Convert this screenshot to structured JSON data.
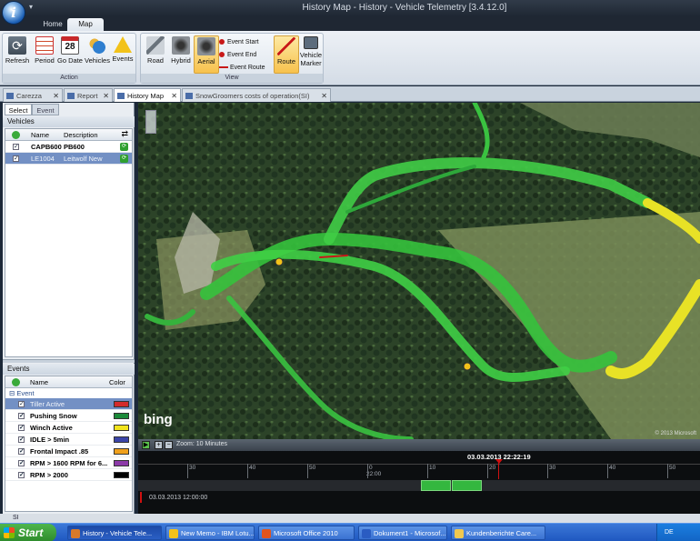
{
  "app": {
    "window_title": "History Map - History - Vehicle Telemetry [3.4.12.0]",
    "ribbon_tabs": [
      "Home",
      "Map"
    ],
    "active_ribbon_tab": "Map"
  },
  "ribbon": {
    "action_group": {
      "label": "Action",
      "buttons": [
        "Refresh",
        "Period",
        "Go Date",
        "Vehicles",
        "Events"
      ],
      "calendar_day": "28"
    },
    "view_group": {
      "label": "View",
      "buttons": [
        "Road",
        "Hybrid",
        "Aerial"
      ],
      "active": "Aerial",
      "small_buttons": [
        "Event Start",
        "Event End",
        "Event Route"
      ],
      "route_label": "Route",
      "vehicle_marker_label": "Vehicle Marker"
    }
  },
  "doc_tabs": [
    "Carezza",
    "Report",
    "History Map",
    "SnowGroomers costs of operation(SI)"
  ],
  "active_doc_tab": "History Map",
  "left_panel": {
    "subtabs": [
      "Select",
      "Event"
    ],
    "vehicles_title": "Vehicles",
    "vehicles_columns": [
      "Name",
      "Description"
    ],
    "vehicles": [
      {
        "name": "CAPB600",
        "description": "PB600",
        "selected": false
      },
      {
        "name": "LE1004",
        "description": "Leitwolf New",
        "selected": true
      }
    ],
    "events_title": "Events",
    "events_columns": [
      "Name",
      "Color"
    ],
    "event_group": "Event",
    "events": [
      {
        "name": "Tiller Active",
        "color": "#d42b2b",
        "selected": true
      },
      {
        "name": "Pushing Snow",
        "color": "#1c8a3a",
        "selected": false
      },
      {
        "name": "Winch Active",
        "color": "#f2e41c",
        "selected": false
      },
      {
        "name": "IDLE > 5min",
        "color": "#3a44a8",
        "selected": false
      },
      {
        "name": "Frontal Impact .85",
        "color": "#f0a01c",
        "selected": false
      },
      {
        "name": "RPM > 1600 RPM for 6...",
        "color": "#8c3aa8",
        "selected": false
      },
      {
        "name": "RPM > 2000",
        "color": "#000000",
        "selected": false
      }
    ]
  },
  "map": {
    "provider_logo": "bing",
    "copyright": "© 2013 Microsoft"
  },
  "timeline": {
    "zoom_label": "Zoom: 10 Minutes",
    "cursor_datetime": "03.03.2013 22:22:19",
    "tick_labels": [
      "30",
      "40",
      "50",
      "0",
      "10",
      "20",
      "30",
      "40",
      "50"
    ],
    "hour_label": "22:00",
    "start_datetime": "03.03.2013 12:00:00"
  },
  "statusbar": {
    "text": "SI"
  },
  "taskbar": {
    "start_label": "Start",
    "tasks": [
      {
        "label": "History - Vehicle Tele...",
        "icon_color": "#d87a2a"
      },
      {
        "label": "New Memo - IBM Lotu...",
        "icon_color": "#f2c21a"
      },
      {
        "label": "Microsoft Office 2010",
        "icon_color": "#e2541c"
      },
      {
        "label": "Dokument1 - Microsof...",
        "icon_color": "#2a5cc2"
      },
      {
        "label": "Kundenberichte Care...",
        "icon_color": "#f0c850"
      }
    ],
    "tray_lang": "DE"
  }
}
